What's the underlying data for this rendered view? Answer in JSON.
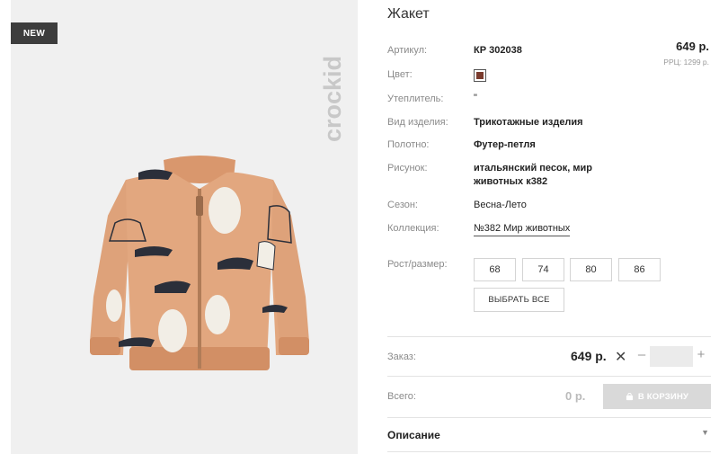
{
  "badge": "NEW",
  "brand": "crockid",
  "product": {
    "title": "Жакет",
    "price": "649 р.",
    "rrp": "РРЦ: 1299 р.",
    "color_hex": "#7a3b2e",
    "rows": {
      "article": {
        "label": "Артикул:",
        "value": "КР 302038"
      },
      "color": {
        "label": "Цвет:"
      },
      "insulation": {
        "label": "Утеплитель:",
        "value": "\""
      },
      "item_type": {
        "label": "Вид изделия:",
        "value": "Трикотажные изделия"
      },
      "fabric": {
        "label": "Полотно:",
        "value": "Футер-петля"
      },
      "pattern": {
        "label": "Рисунок:",
        "value_line1": "итальянский песок, мир",
        "value_line2": "животных к382"
      },
      "season": {
        "label": "Сезон:",
        "value": "Весна-Лето"
      },
      "collection": {
        "label": "Коллекция:",
        "value": "№382 Мир животных"
      }
    },
    "sizes": {
      "label": "Рост/размер:",
      "options": [
        "68",
        "74",
        "80",
        "86"
      ],
      "select_all": "ВЫБРАТЬ ВСЕ"
    }
  },
  "order": {
    "label": "Заказ:",
    "price": "649 р.",
    "quantity": "",
    "minus": "–",
    "plus": "+"
  },
  "total": {
    "label": "Всего:",
    "value": "0 р.",
    "cart_button": "В КОРЗИНУ"
  },
  "description": {
    "label": "Описание"
  },
  "colors": {
    "jacket": "#e2a77f",
    "badge_bg": "#3d3d3d",
    "cart_bg": "#d9d9d9"
  }
}
